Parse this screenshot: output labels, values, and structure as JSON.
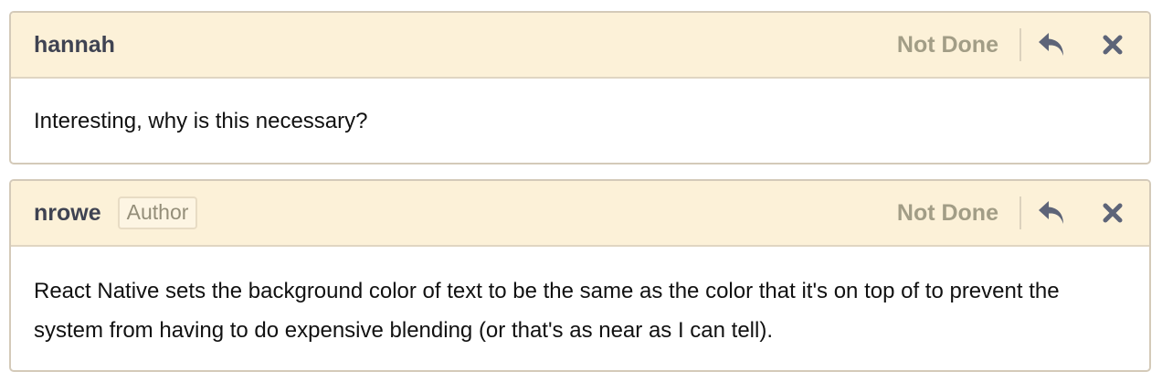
{
  "comments": [
    {
      "author": "hannah",
      "status_label": "Not Done",
      "reply_icon": "reply-arrow-icon",
      "close_icon": "close-x-icon",
      "text": "Interesting, why is this necessary?"
    },
    {
      "author": "nrowe",
      "badge": "Author",
      "status_label": "Not Done",
      "reply_icon": "reply-arrow-icon",
      "close_icon": "close-x-icon",
      "text": "React Native sets the background color of text to be the same as the color that it's on top of to prevent the system from having to do expensive blending (or that's as near as I can tell)."
    }
  ],
  "colors": {
    "header_bg": "#fcf1d8",
    "border": "#d4cab9",
    "author_text": "#3f4352",
    "status_text": "#a29d86",
    "icon": "#5d6478"
  }
}
